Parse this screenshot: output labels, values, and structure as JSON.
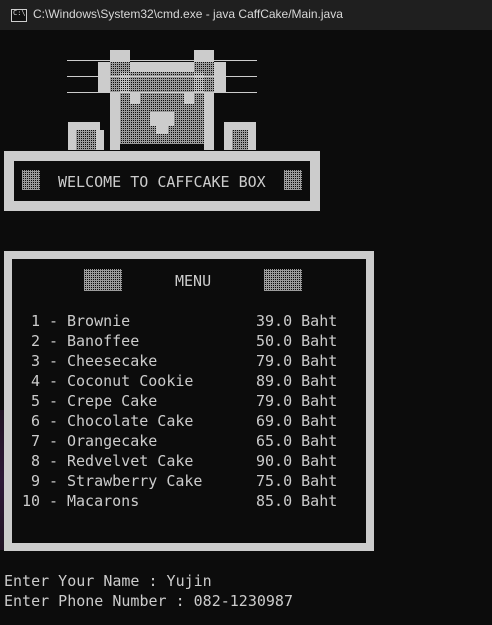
{
  "window": {
    "title": "C:\\Windows\\System32\\cmd.exe - java  CaffCake/Main.java",
    "icon": "cmd-icon"
  },
  "banner": {
    "text": "WELCOME TO CAFFCAKE BOX"
  },
  "menu": {
    "title": "MENU",
    "items": [
      {
        "num": "1",
        "name": "Brownie",
        "price": "39.0 Baht"
      },
      {
        "num": "2",
        "name": "Banoffee",
        "price": "50.0 Baht"
      },
      {
        "num": "3",
        "name": "Cheesecake",
        "price": "79.0 Baht"
      },
      {
        "num": "4",
        "name": "Coconut Cookie",
        "price": "89.0 Baht"
      },
      {
        "num": "5",
        "name": "Crepe Cake",
        "price": "79.0 Baht"
      },
      {
        "num": "6",
        "name": "Chocolate Cake",
        "price": "69.0 Baht"
      },
      {
        "num": "7",
        "name": "Orangecake",
        "price": "65.0 Baht"
      },
      {
        "num": "8",
        "name": "Redvelvet Cake",
        "price": "90.0 Baht"
      },
      {
        "num": "9",
        "name": "Strawberry Cake",
        "price": "75.0 Baht"
      },
      {
        "num": "10",
        "name": "Macarons",
        "price": "85.0 Baht"
      }
    ]
  },
  "prompts": [
    "Enter Your Name : Yujin",
    "Enter Phone Number : 082-1230987"
  ],
  "colors": {
    "background": "#0c0c0c",
    "text": "#cccccc",
    "titlebar": "#1f1f1f"
  }
}
